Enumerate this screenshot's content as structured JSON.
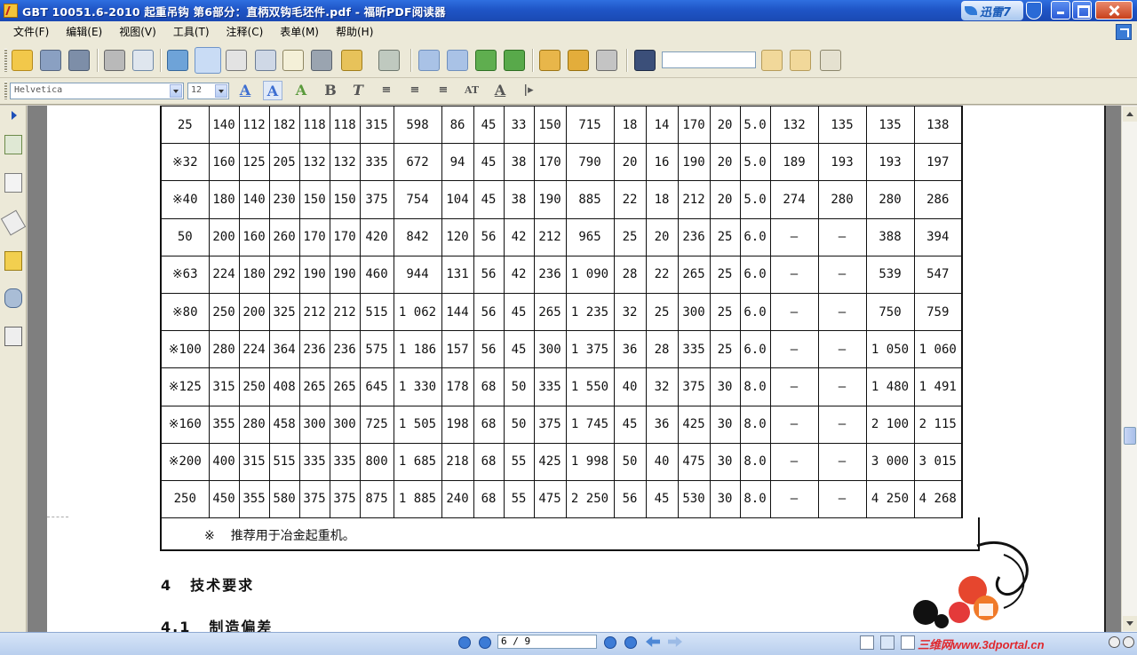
{
  "window": {
    "title": "GBT 10051.6-2010 起重吊钩 第6部分：直柄双钩毛坯件.pdf - 福昕PDF阅读器",
    "xunlei_label": "迅雷7"
  },
  "menu": [
    {
      "label": "文件(F)"
    },
    {
      "label": "编辑(E)"
    },
    {
      "label": "视图(V)"
    },
    {
      "label": "工具(T)"
    },
    {
      "label": "注释(C)"
    },
    {
      "label": "表单(M)"
    },
    {
      "label": "帮助(H)"
    }
  ],
  "format_bar": {
    "font_name": "Helvetica",
    "font_size": "12"
  },
  "table": {
    "rows": [
      [
        "25",
        "140",
        "112",
        "182",
        "118",
        "118",
        "315",
        "598",
        "86",
        "45",
        "33",
        "150",
        "715",
        "18",
        "14",
        "170",
        "20",
        "5.0",
        "132",
        "135",
        "135",
        "138"
      ],
      [
        "※32",
        "160",
        "125",
        "205",
        "132",
        "132",
        "335",
        "672",
        "94",
        "45",
        "38",
        "170",
        "790",
        "20",
        "16",
        "190",
        "20",
        "5.0",
        "189",
        "193",
        "193",
        "197"
      ],
      [
        "※40",
        "180",
        "140",
        "230",
        "150",
        "150",
        "375",
        "754",
        "104",
        "45",
        "38",
        "190",
        "885",
        "22",
        "18",
        "212",
        "20",
        "5.0",
        "274",
        "280",
        "280",
        "286"
      ],
      [
        "50",
        "200",
        "160",
        "260",
        "170",
        "170",
        "420",
        "842",
        "120",
        "56",
        "42",
        "212",
        "965",
        "25",
        "20",
        "236",
        "25",
        "6.0",
        "—",
        "—",
        "388",
        "394"
      ],
      [
        "※63",
        "224",
        "180",
        "292",
        "190",
        "190",
        "460",
        "944",
        "131",
        "56",
        "42",
        "236",
        "1 090",
        "28",
        "22",
        "265",
        "25",
        "6.0",
        "—",
        "—",
        "539",
        "547"
      ],
      [
        "※80",
        "250",
        "200",
        "325",
        "212",
        "212",
        "515",
        "1 062",
        "144",
        "56",
        "45",
        "265",
        "1 235",
        "32",
        "25",
        "300",
        "25",
        "6.0",
        "—",
        "—",
        "750",
        "759"
      ],
      [
        "※100",
        "280",
        "224",
        "364",
        "236",
        "236",
        "575",
        "1 186",
        "157",
        "56",
        "45",
        "300",
        "1 375",
        "36",
        "28",
        "335",
        "25",
        "6.0",
        "—",
        "—",
        "1 050",
        "1 060"
      ],
      [
        "※125",
        "315",
        "250",
        "408",
        "265",
        "265",
        "645",
        "1 330",
        "178",
        "68",
        "50",
        "335",
        "1 550",
        "40",
        "32",
        "375",
        "30",
        "8.0",
        "—",
        "—",
        "1 480",
        "1 491"
      ],
      [
        "※160",
        "355",
        "280",
        "458",
        "300",
        "300",
        "725",
        "1 505",
        "198",
        "68",
        "50",
        "375",
        "1 745",
        "45",
        "36",
        "425",
        "30",
        "8.0",
        "—",
        "—",
        "2 100",
        "2 115"
      ],
      [
        "※200",
        "400",
        "315",
        "515",
        "335",
        "335",
        "800",
        "1 685",
        "218",
        "68",
        "55",
        "425",
        "1 998",
        "50",
        "40",
        "475",
        "30",
        "8.0",
        "—",
        "—",
        "3 000",
        "3 015"
      ],
      [
        "250",
        "450",
        "355",
        "580",
        "375",
        "375",
        "875",
        "1 885",
        "240",
        "68",
        "55",
        "475",
        "2 250",
        "56",
        "45",
        "530",
        "30",
        "8.0",
        "—",
        "—",
        "4 250",
        "4 268"
      ]
    ]
  },
  "footnote": {
    "mark": "※",
    "text": "推荐用于冶金起重机。"
  },
  "section": {
    "num": "4",
    "title": "技术要求"
  },
  "subsection": {
    "num": "4.1",
    "title": "制造偏差"
  },
  "statusbar": {
    "page_indicator": "6 / 9",
    "site_label": "三维网www.3dportal.cn"
  },
  "colors": {
    "titlebar": "#1f55c6",
    "chrome": "#ece9d8",
    "doc_background": "#7f7f7f",
    "watermark": "#e0282e"
  }
}
